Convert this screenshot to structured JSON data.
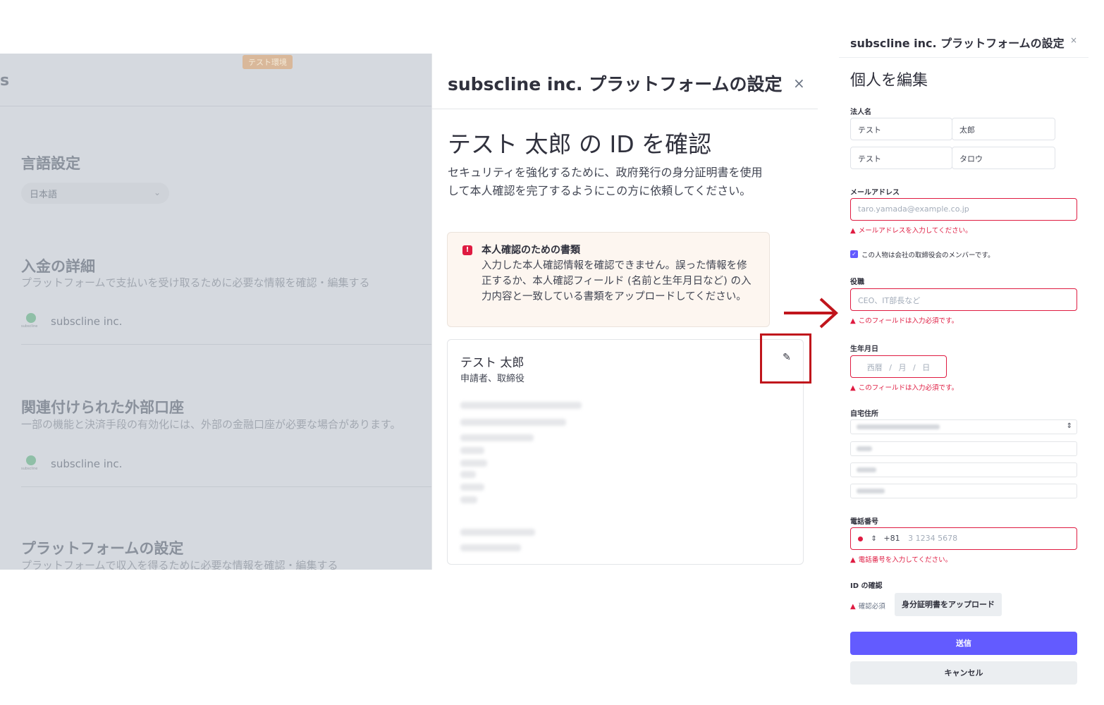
{
  "background_page": {
    "env_badge": "テスト環境",
    "brand_letter": "s",
    "language": {
      "title": "言語設定",
      "selected": "日本語"
    },
    "payout": {
      "title": "入金の詳細",
      "subtitle": "プラットフォームで支払いを受け取るために必要な情報を確認・編集する",
      "account": "subscline inc."
    },
    "external": {
      "title": "関連付けられた外部口座",
      "subtitle": "一部の機能と決済手段の有効化には、外部の金融口座が必要な場合があります。",
      "account": "subscline inc."
    },
    "platform": {
      "title": "プラットフォームの設定",
      "subtitle": "プラットフォームで収入を得るために必要な情報を確認・編集する"
    },
    "logo_text": "subscline"
  },
  "middle_modal": {
    "title": "subscline inc. プラットフォームの設定",
    "close": "×",
    "heading": "テスト 太郎 の ID を確認",
    "description": "セキュリティを強化するために、政府発行の身分証明書を使用して本人確認を完了するようにこの方に依頼してください。",
    "alert": {
      "title": "本人確認のための書類",
      "body": "入力した本人確認情報を確認できません。誤った情報を修正するか、本人確認フィールド (名前と生年月日など) の入力内容と一致している書類をアップロードしてください。"
    },
    "person": {
      "name": "テスト 太郎",
      "role": "申請者、取締役"
    }
  },
  "right_panel": {
    "title": "subscline inc. プラットフォームの設定",
    "close": "×",
    "heading": "個人を編集",
    "legal_name": {
      "label": "法人名",
      "last": "テスト",
      "first": "太郎",
      "last_kana": "テスト",
      "first_kana": "タロウ"
    },
    "email": {
      "label": "メールアドレス",
      "placeholder": "taro.yamada@example.co.jp",
      "error": "メールアドレスを入力してください。"
    },
    "director_checkbox": "この人物は会社の取締役会のメンバーです。",
    "title_field": {
      "label": "役職",
      "placeholder": "CEO、IT部長など",
      "error": "このフィールドは入力必須です。"
    },
    "dob": {
      "label": "生年月日",
      "era": "西暦",
      "month": "月",
      "day": "日",
      "sep": "/",
      "error": "このフィールドは入力必須です。"
    },
    "address": {
      "label": "自宅住所"
    },
    "phone": {
      "label": "電話番号",
      "code": "+81",
      "placeholder": "3 1234 5678",
      "error": "電話番号を入力してください。"
    },
    "id_verify": {
      "label": "ID の確認",
      "status": "確認必須",
      "upload": "身分証明書をアップロード"
    },
    "submit": "送信",
    "cancel": "キャンセル"
  },
  "colors": {
    "accent": "#635bff",
    "error": "#df1b41",
    "highlight": "#c0151c"
  }
}
